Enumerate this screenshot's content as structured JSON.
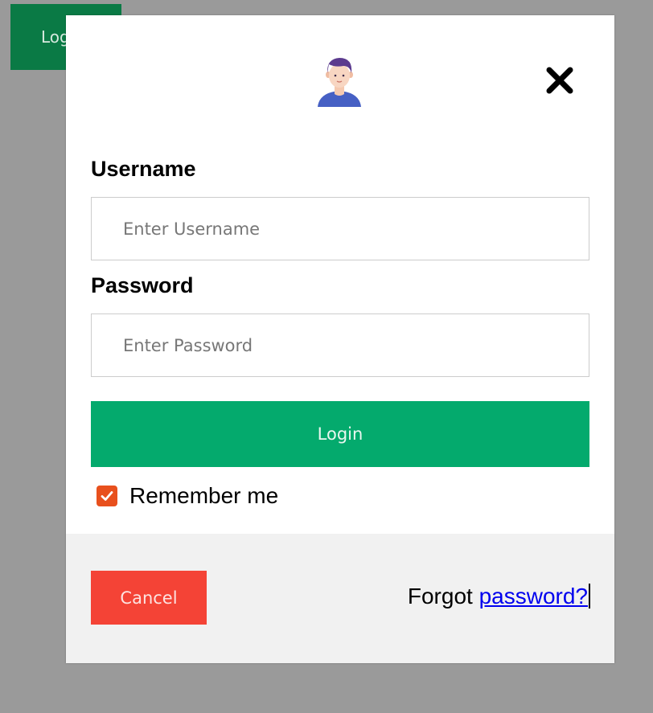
{
  "background": {
    "open_login_label": "Login"
  },
  "modal": {
    "avatar_icon": "user-avatar-icon",
    "close_icon": "close-icon",
    "username": {
      "label": "Username",
      "placeholder": "Enter Username",
      "value": ""
    },
    "password": {
      "label": "Password",
      "placeholder": "Enter Password",
      "value": ""
    },
    "login_label": "Login",
    "remember": {
      "label": "Remember me",
      "checked": true
    },
    "footer": {
      "cancel_label": "Cancel",
      "forgot_prefix": "Forgot",
      "forgot_link": "password?"
    }
  },
  "colors": {
    "page_overlay": "#9a9a9a",
    "primary_green": "#04aa6d",
    "background_button_green": "#0a7a45",
    "cancel_red": "#f44336",
    "checkbox_orange": "#e8501d",
    "link_blue": "#0000ee",
    "footer_gray": "#f1f1f1"
  }
}
